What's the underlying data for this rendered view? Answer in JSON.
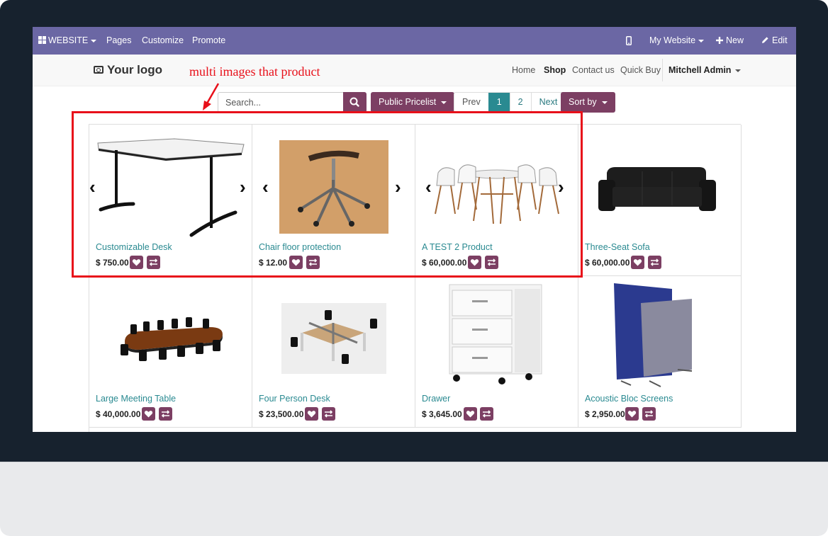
{
  "admin_bar": {
    "website_label": "WEBSITE",
    "pages": "Pages",
    "customize": "Customize",
    "promote": "Promote",
    "my_website": "My Website",
    "new": "New",
    "edit": "Edit"
  },
  "header": {
    "logo": "Your logo",
    "nav": [
      "Home",
      "Shop",
      "Contact us",
      "Quick Buy"
    ],
    "user": "Mitchell Admin"
  },
  "annotation": "multi images that product",
  "toolbar": {
    "search_placeholder": "Search...",
    "pricelist": "Public Pricelist",
    "pager": [
      "Prev",
      "1",
      "2",
      "Next"
    ],
    "sort": "Sort by"
  },
  "products": [
    {
      "name": "Customizable Desk",
      "price": "$ 750.00"
    },
    {
      "name": "Chair floor protection",
      "price": "$ 12.00"
    },
    {
      "name": "A TEST 2 Product",
      "price": "$ 60,000.00"
    },
    {
      "name": "Three-Seat Sofa",
      "price": "$ 60,000.00"
    },
    {
      "name": "Large Meeting Table",
      "price": "$ 40,000.00"
    },
    {
      "name": "Four Person Desk",
      "price": "$ 23,500.00"
    },
    {
      "name": "Drawer",
      "price": "$ 3,645.00"
    },
    {
      "name": "Acoustic Bloc Screens",
      "price": "$ 2,950.00"
    }
  ],
  "colors": {
    "admin_bar": "#6b67a4",
    "accent": "#7c3f63",
    "link": "#2a8a91",
    "highlight": "#e8101a"
  }
}
